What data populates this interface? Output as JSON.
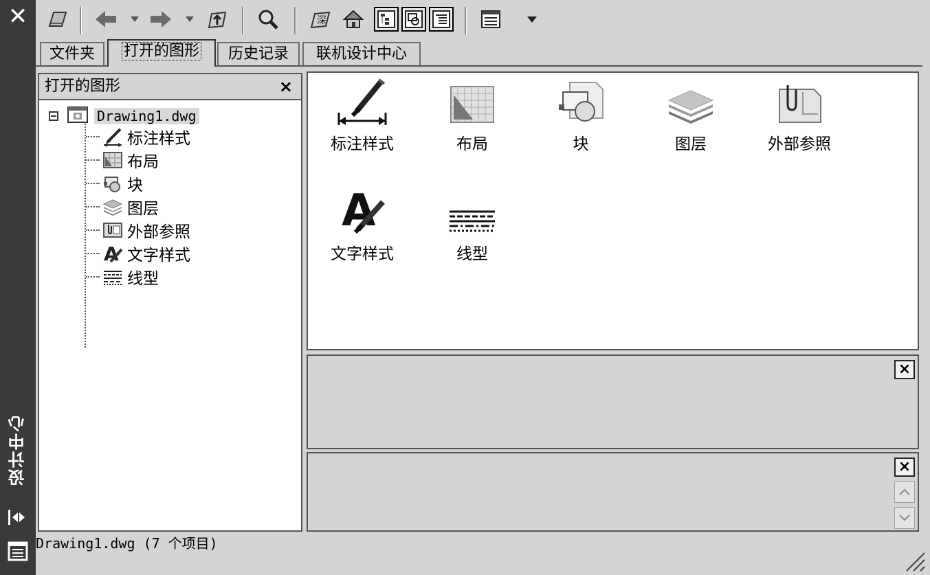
{
  "window": {
    "title": "设计中心"
  },
  "toolbar": {
    "buttons": [
      "load-icon",
      "back-icon",
      "forward-icon",
      "up-icon",
      "search-icon",
      "favorites-icon",
      "home-icon",
      "tree-toggle-icon",
      "preview-icon",
      "description-icon",
      "views-icon"
    ]
  },
  "tabs": [
    {
      "label": "文件夹"
    },
    {
      "label": "打开的图形"
    },
    {
      "label": "历史记录"
    },
    {
      "label": "联机设计中心"
    }
  ],
  "tree": {
    "header": "打开的图形",
    "close": "×",
    "root": "Drawing1.dwg",
    "items": [
      {
        "label": "标注样式",
        "icon": "dimstyle-icon"
      },
      {
        "label": "布局",
        "icon": "layout-icon"
      },
      {
        "label": "块",
        "icon": "block-icon"
      },
      {
        "label": "图层",
        "icon": "layer-icon"
      },
      {
        "label": "外部参照",
        "icon": "xref-icon"
      },
      {
        "label": "文字样式",
        "icon": "textstyle-icon"
      },
      {
        "label": "线型",
        "icon": "linetype-icon"
      }
    ]
  },
  "content": {
    "items": [
      {
        "label": "标注样式"
      },
      {
        "label": "布局"
      },
      {
        "label": "块"
      },
      {
        "label": "图层"
      },
      {
        "label": "外部参照"
      },
      {
        "label": "文字样式"
      },
      {
        "label": "线型"
      }
    ]
  },
  "preview": {
    "close": "×"
  },
  "description": {
    "close": "×"
  },
  "status": {
    "text": "Drawing1.dwg (7 个项目)"
  }
}
